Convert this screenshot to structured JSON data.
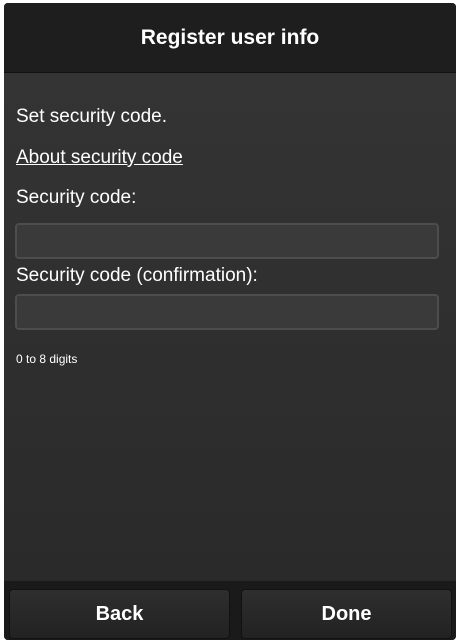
{
  "header": {
    "title": "Register user info"
  },
  "main": {
    "instruction": "Set security code.",
    "about_link": "About security code",
    "security_code_label": "Security code:",
    "security_code_value": "",
    "confirmation_label": "Security code (confirmation):",
    "confirmation_value": "",
    "hint": "0 to 8 digits"
  },
  "footer": {
    "back_label": "Back",
    "done_label": "Done"
  }
}
